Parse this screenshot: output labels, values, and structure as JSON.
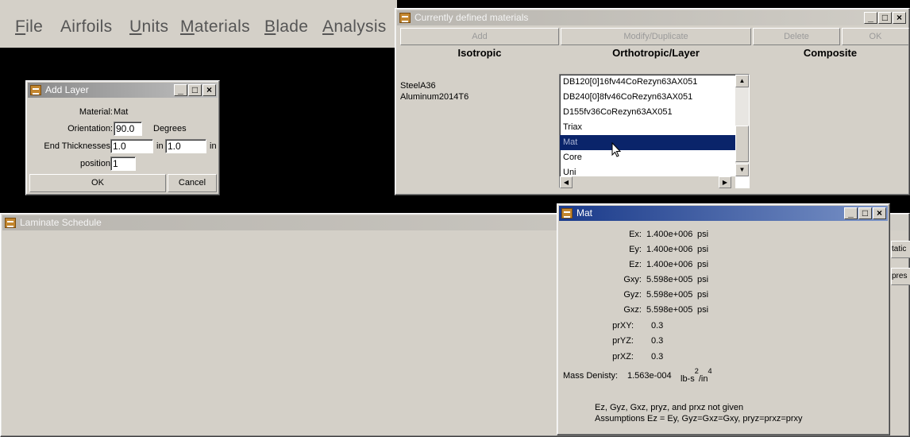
{
  "menubar": {
    "items": [
      {
        "label": "File",
        "underline": "F"
      },
      {
        "label": "Airfoils",
        "underline": ""
      },
      {
        "label": "Units",
        "underline": "U"
      },
      {
        "label": "Materials",
        "underline": "M"
      },
      {
        "label": "Blade",
        "underline": "B"
      },
      {
        "label": "Analysis",
        "underline": "A"
      }
    ]
  },
  "materials_window": {
    "title": "Currently defined materials",
    "buttons": {
      "add": "Add",
      "modify": "Modify/Duplicate",
      "delete": "Delete",
      "ok": "OK"
    },
    "columns": {
      "isotropic": "Isotropic",
      "orthotropic": "Orthotropic/Layer",
      "composite": "Composite"
    },
    "isotropic_items": [
      "SteelA36",
      "Aluminum2014T6"
    ],
    "orthotropic_items": [
      "DB120[0]16fv44CoRezyn63AX051",
      "DB240[0]8fv46CoRezyn63AX051",
      "D155fv36CoRezyn63AX051",
      "Triax",
      "Mat",
      "Core",
      "Uni"
    ],
    "selected_item": "Mat"
  },
  "add_layer_dialog": {
    "title": "Add Layer",
    "material_label": "Material:",
    "material_value": "Mat",
    "orientation_label": "Orientation:",
    "orientation_value": "90.0",
    "orientation_unit": "Degrees",
    "thickness_label": "End Thicknesses:",
    "thickness_1": "1.0",
    "thickness_unit_1": "in",
    "thickness_2": "1.0",
    "thickness_unit_2": "in",
    "position_label": "position:",
    "position_value": "1",
    "ok_label": "OK",
    "cancel_label": "Cancel"
  },
  "laminate_window": {
    "title": "Laminate Schedule",
    "right_clip_1": "tatic",
    "right_clip_2": "pres"
  },
  "mat_window": {
    "title": "Mat",
    "props": [
      {
        "name": "Ex:",
        "value": "1.400e+006",
        "unit": "psi"
      },
      {
        "name": "Ey:",
        "value": "1.400e+006",
        "unit": "psi"
      },
      {
        "name": "Ez:",
        "value": "1.400e+006",
        "unit": "psi"
      },
      {
        "name": "Gxy:",
        "value": "5.598e+005",
        "unit": "psi"
      },
      {
        "name": "Gyz:",
        "value": "5.598e+005",
        "unit": "psi"
      },
      {
        "name": "Gxz:",
        "value": "5.598e+005",
        "unit": "psi"
      },
      {
        "name": "prXY:",
        "value": "0.3",
        "unit": ""
      },
      {
        "name": "prYZ:",
        "value": "0.3",
        "unit": ""
      },
      {
        "name": "prXZ:",
        "value": "0.3",
        "unit": ""
      }
    ],
    "density_label": "Mass Denisty:",
    "density_value": "1.563e-004",
    "density_unit_a": "lb-s",
    "density_unit_sup1": "2",
    "density_unit_b": "/in",
    "density_unit_sup2": "4",
    "note_1": "Ez, Gyz, Gxz, pryz, and prxz not given",
    "note_2": "Assumptions Ez = Ey, Gyz=Gxz=Gxy, pryz=prxz=prxy"
  },
  "colors": {
    "face": "#d4d0c8",
    "selection": "#0a246a",
    "active_title": "#1a3a8a"
  }
}
